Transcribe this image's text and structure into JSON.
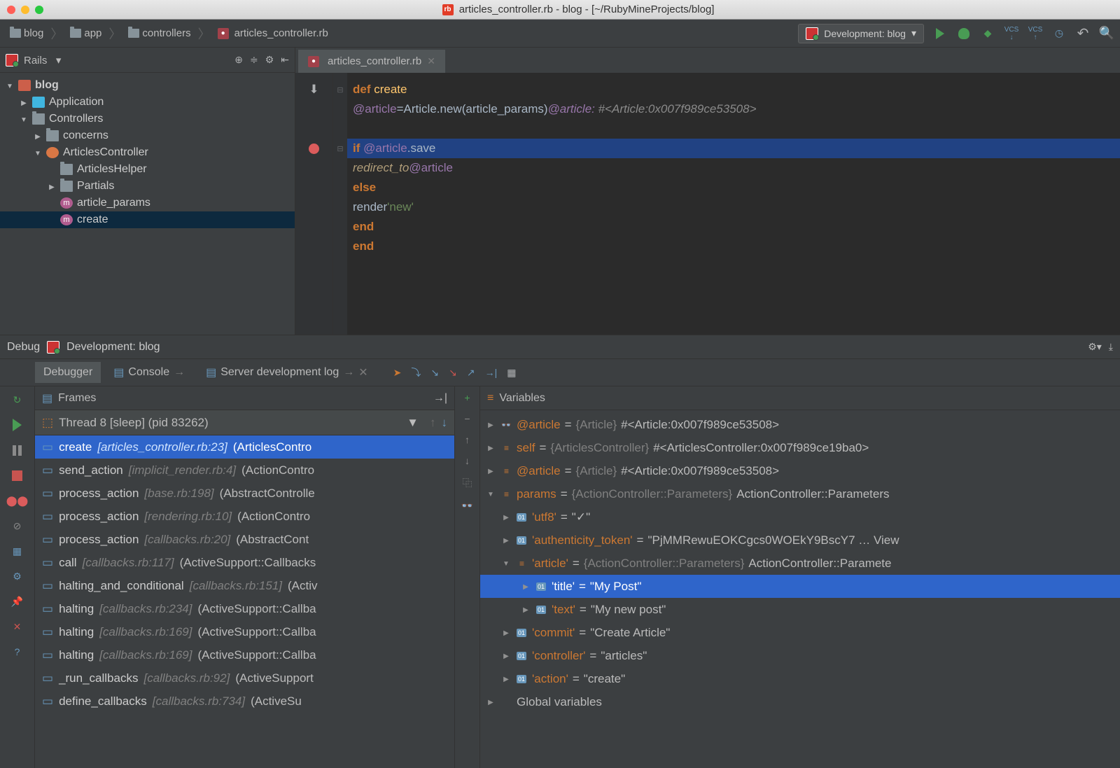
{
  "window_title": "articles_controller.rb - blog - [~/RubyMineProjects/blog]",
  "breadcrumbs": [
    "blog",
    "app",
    "controllers",
    "articles_controller.rb"
  ],
  "run_config": "Development: blog",
  "sidebar_label": "Rails",
  "project_tree": [
    {
      "level": 0,
      "arrow": "down",
      "icon": "blog",
      "label": "blog",
      "sel": false
    },
    {
      "level": 1,
      "arrow": "right",
      "icon": "cube",
      "label": "Application",
      "sel": false
    },
    {
      "level": 1,
      "arrow": "down",
      "icon": "folder",
      "label": "Controllers",
      "sel": false
    },
    {
      "level": 2,
      "arrow": "right",
      "icon": "folder",
      "label": "concerns",
      "sel": false
    },
    {
      "level": 2,
      "arrow": "down",
      "icon": "class",
      "label": "ArticlesController",
      "sel": false
    },
    {
      "level": 3,
      "arrow": "none",
      "icon": "folder",
      "label": "ArticlesHelper",
      "sel": false
    },
    {
      "level": 3,
      "arrow": "right",
      "icon": "folder",
      "label": "Partials",
      "sel": false
    },
    {
      "level": 3,
      "arrow": "none",
      "icon": "method",
      "label": "article_params",
      "sel": false
    },
    {
      "level": 3,
      "arrow": "none",
      "icon": "method",
      "label": "create",
      "sel": true
    }
  ],
  "editor_tab": "articles_controller.rb",
  "code_lines": [
    {
      "hl": false,
      "bp": false,
      "html": "<span class='kw'>def </span><span class='method'>create</span>"
    },
    {
      "hl": false,
      "bp": false,
      "html": "  <span class='ivar'>@article</span> <span class='op'>=</span> <span class='const'>Article</span><span class='op'>.</span><span class='ident'>new</span><span class='op'>(</span><span class='ident'>article_params</span><span class='op'>)</span>   <span class='inlay'><span class='iv'>@article:</span> #&lt;Article:0x007f989ce53508&gt;</span>"
    },
    {
      "hl": false,
      "bp": false,
      "html": ""
    },
    {
      "hl": true,
      "bp": true,
      "html": "  <span class='kw'>if </span><span class='ivar'>@article</span><span class='op'>.</span><span class='ident'>save</span>"
    },
    {
      "hl": false,
      "bp": false,
      "html": "    <span class='call'>redirect_to</span> <span class='ivar'>@article</span>"
    },
    {
      "hl": false,
      "bp": false,
      "html": "  <span class='kw'>else</span>"
    },
    {
      "hl": false,
      "bp": false,
      "html": "    <span class='ident'>render</span> <span class='str'>'new'</span>"
    },
    {
      "hl": false,
      "bp": false,
      "html": "  <span class='kw'>end</span>"
    },
    {
      "hl": false,
      "bp": false,
      "html": "<span class='kw'>end</span>"
    }
  ],
  "debug_label": "Debug",
  "debug_config": "Development: blog",
  "debug_tabs": [
    "Debugger",
    "Console",
    "Server development log"
  ],
  "frames_label": "Frames",
  "thread_label": "Thread 8 [sleep] (pid 83262)",
  "frames": [
    {
      "sel": true,
      "name": "create",
      "loc": "[articles_controller.rb:23]",
      "rest": "(ArticlesContro"
    },
    {
      "sel": false,
      "name": "send_action",
      "loc": "[implicit_render.rb:4]",
      "rest": "(ActionContro"
    },
    {
      "sel": false,
      "name": "process_action",
      "loc": "[base.rb:198]",
      "rest": "(AbstractControlle"
    },
    {
      "sel": false,
      "name": "process_action",
      "loc": "[rendering.rb:10]",
      "rest": "(ActionContro"
    },
    {
      "sel": false,
      "name": "process_action",
      "loc": "[callbacks.rb:20]",
      "rest": "(AbstractCont"
    },
    {
      "sel": false,
      "name": "call",
      "loc": "[callbacks.rb:117]",
      "rest": "(ActiveSupport::Callbacks"
    },
    {
      "sel": false,
      "name": "halting_and_conditional",
      "loc": "[callbacks.rb:151]",
      "rest": "(Activ"
    },
    {
      "sel": false,
      "name": "halting",
      "loc": "[callbacks.rb:234]",
      "rest": "(ActiveSupport::Callba"
    },
    {
      "sel": false,
      "name": "halting",
      "loc": "[callbacks.rb:169]",
      "rest": "(ActiveSupport::Callba"
    },
    {
      "sel": false,
      "name": "halting",
      "loc": "[callbacks.rb:169]",
      "rest": "(ActiveSupport::Callba"
    },
    {
      "sel": false,
      "name": "_run_callbacks",
      "loc": "[callbacks.rb:92]",
      "rest": "(ActiveSupport"
    },
    {
      "sel": false,
      "name": "define_callbacks",
      "loc": "[callbacks.rb:734]",
      "rest": "(ActiveSu"
    }
  ],
  "vars_label": "Variables",
  "variables": [
    {
      "ind": 0,
      "exp": "r",
      "icon": "watch",
      "name": "@article",
      "type": "{Article}",
      "val": "#<Article:0x007f989ce53508>"
    },
    {
      "ind": 0,
      "exp": "r",
      "icon": "obj",
      "name": "self",
      "type": "{ArticlesController}",
      "val": "#<ArticlesController:0x007f989ce19ba0>"
    },
    {
      "ind": 0,
      "exp": "r",
      "icon": "obj",
      "name": "@article",
      "type": "{Article}",
      "val": "#<Article:0x007f989ce53508>"
    },
    {
      "ind": 0,
      "exp": "d",
      "icon": "obj",
      "name": "params",
      "type": "{ActionController::Parameters}",
      "val": "ActionController::Parameters"
    },
    {
      "ind": 1,
      "exp": "r",
      "icon": "key",
      "name": "'utf8'",
      "type": "",
      "val": "\"✓\""
    },
    {
      "ind": 1,
      "exp": "r",
      "icon": "key",
      "name": "'authenticity_token'",
      "type": "",
      "val": "\"PjMMRewuEOKCgcs0WOEkY9BscY7 … View"
    },
    {
      "ind": 1,
      "exp": "d",
      "icon": "obj",
      "name": "'article'",
      "type": "{ActionController::Parameters}",
      "val": "ActionController::Paramete"
    },
    {
      "ind": 2,
      "exp": "r",
      "icon": "key",
      "name": "'title'",
      "type": "",
      "val": "\"My Post\"",
      "sel": true
    },
    {
      "ind": 2,
      "exp": "r",
      "icon": "key",
      "name": "'text'",
      "type": "",
      "val": "\"My new post\""
    },
    {
      "ind": 1,
      "exp": "r",
      "icon": "key",
      "name": "'commit'",
      "type": "",
      "val": "\"Create Article\""
    },
    {
      "ind": 1,
      "exp": "r",
      "icon": "key",
      "name": "'controller'",
      "type": "",
      "val": "\"articles\""
    },
    {
      "ind": 1,
      "exp": "r",
      "icon": "key",
      "name": "'action'",
      "type": "",
      "val": "\"create\""
    },
    {
      "ind": 0,
      "exp": "r",
      "icon": "none",
      "name_plain": "Global variables"
    }
  ]
}
